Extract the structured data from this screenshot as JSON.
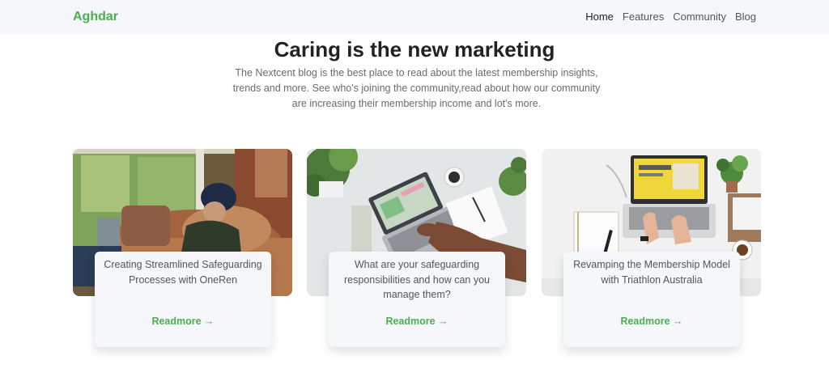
{
  "navbar": {
    "brand": "Aghdar",
    "links": [
      "Home",
      "Features",
      "Community",
      "Blog"
    ]
  },
  "hero": {
    "title": "Caring is the new marketing",
    "description": "The Nextcent blog is the best place to read about the latest membership insights, trends and more. See who's joining the community,read about how our community are increasing their membership income and lot's more."
  },
  "cards": [
    {
      "title": "Creating Streamlined Safeguarding Processes with OneRen",
      "link": "Readmore →"
    },
    {
      "title": "What are your safeguarding responsibilities and how can you manage them?",
      "link": "Readmore →"
    },
    {
      "title": "Revamping the Membership Model with Triathlon Australia",
      "link": "Readmore →"
    }
  ],
  "colors": {
    "brand": "#4caf4f",
    "navbar_bg": "#f5f7fa",
    "heading": "#222222"
  }
}
